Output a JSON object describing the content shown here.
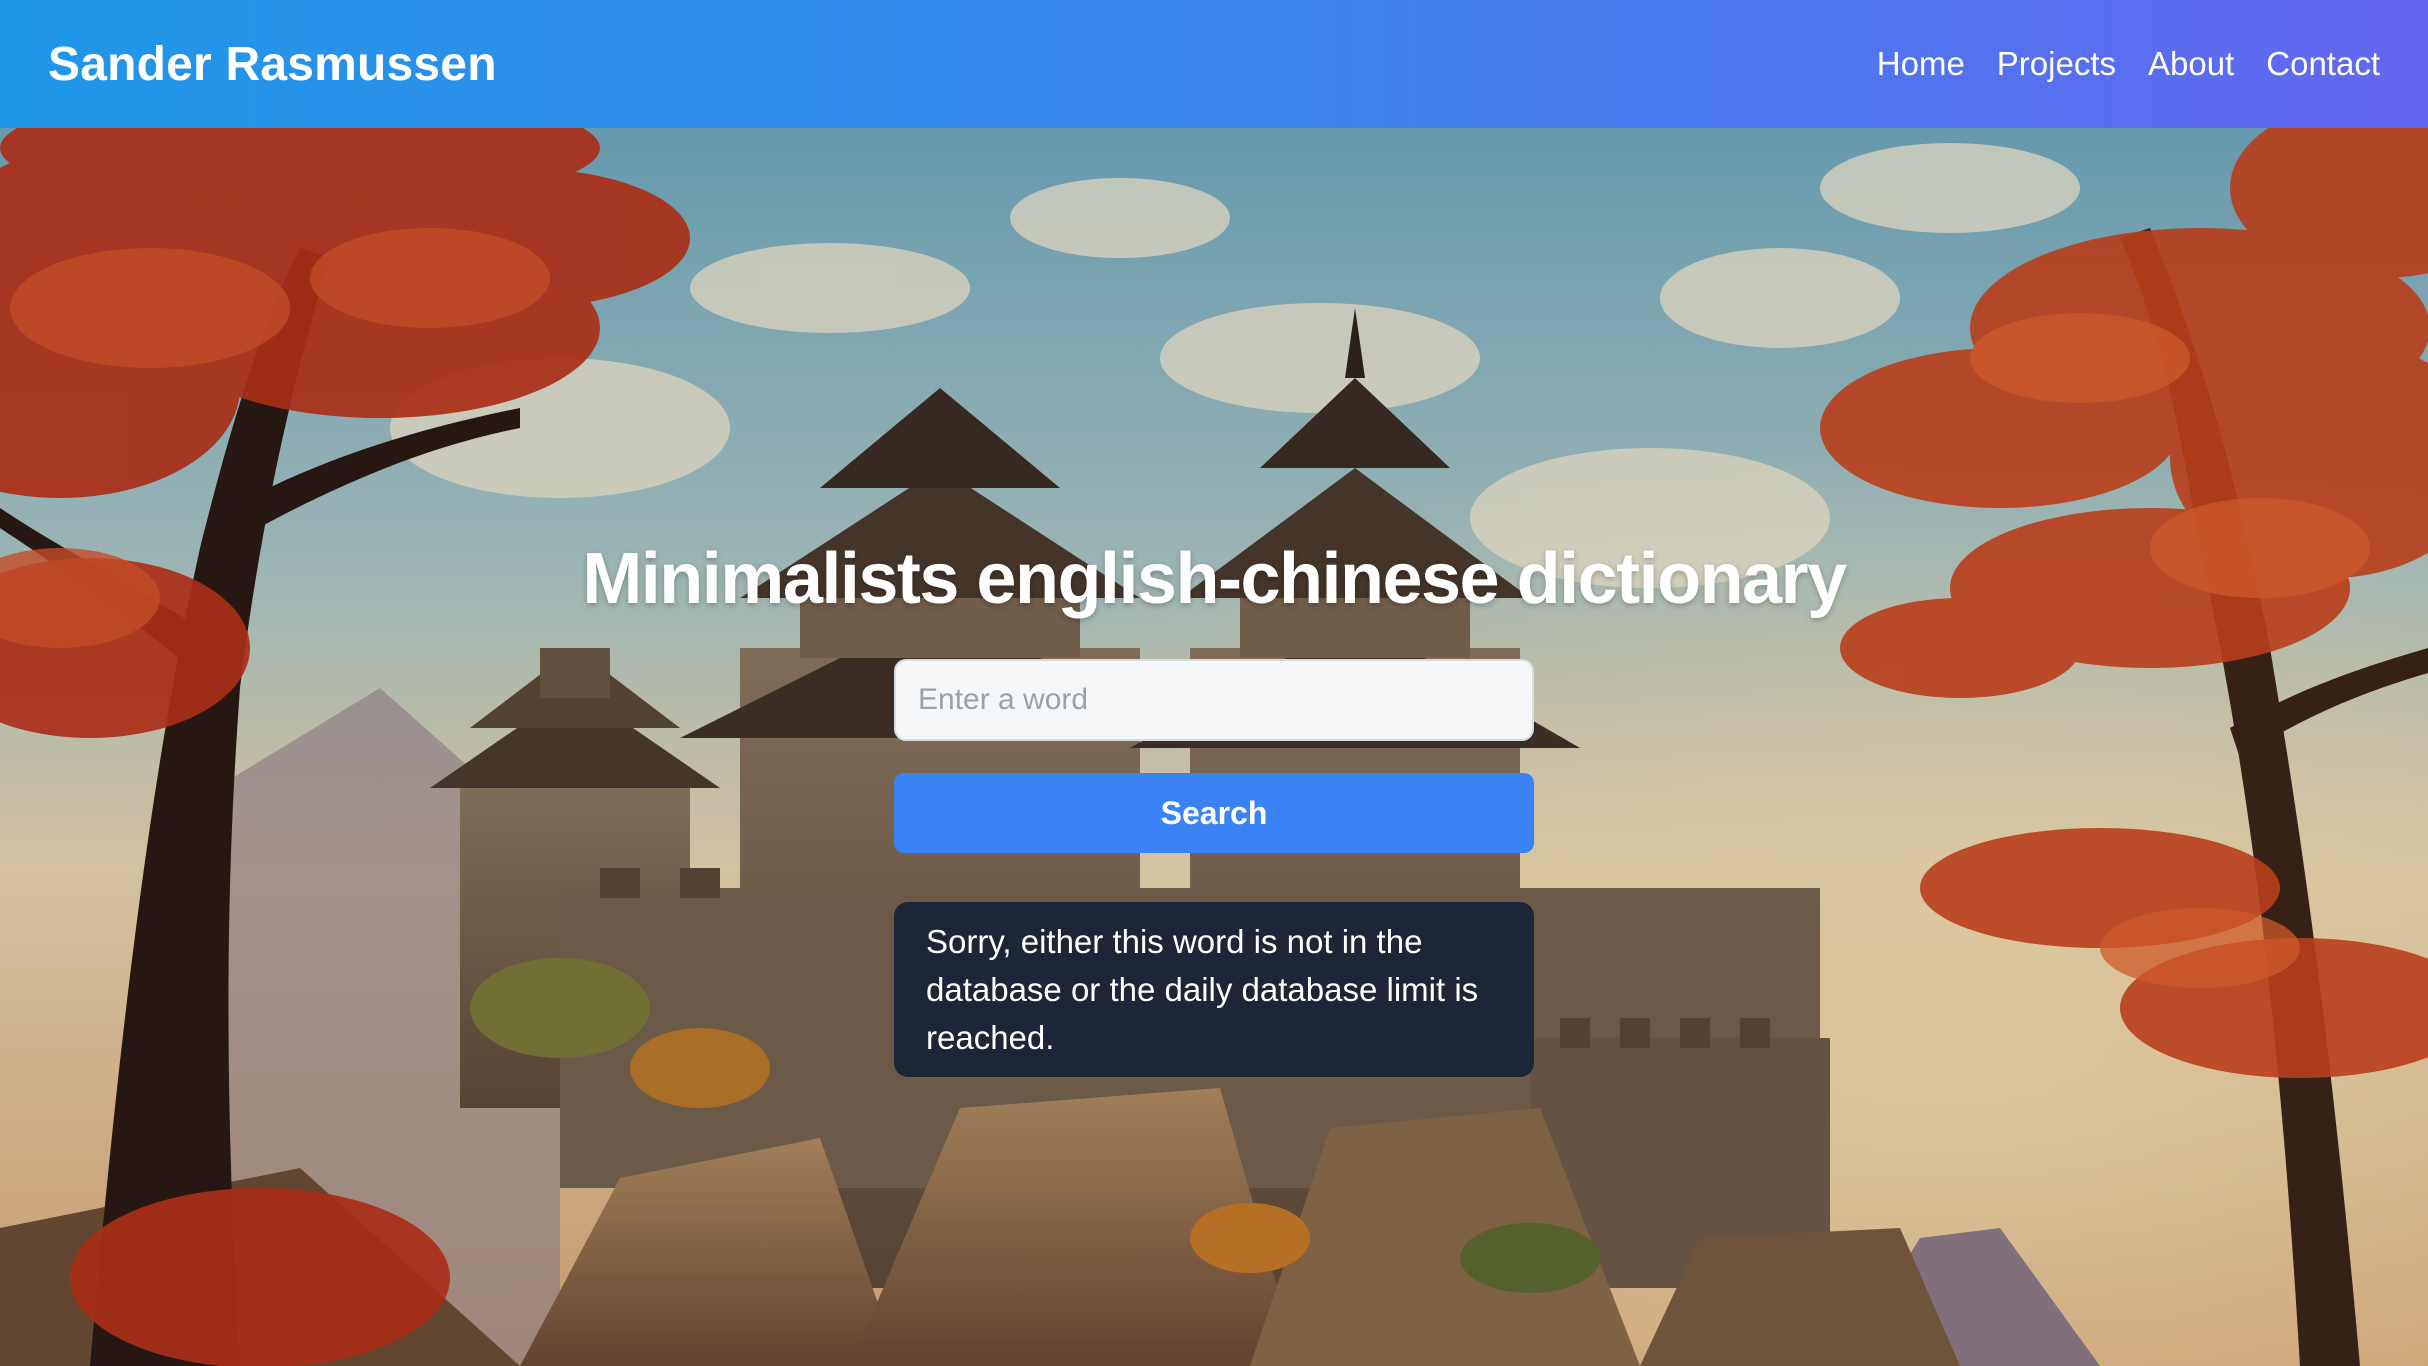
{
  "header": {
    "brand": "Sander Rasmussen",
    "nav": [
      "Home",
      "Projects",
      "About",
      "Contact"
    ],
    "gradient": [
      "#1f97e8",
      "#6366f1"
    ]
  },
  "hero": {
    "title": "Minimalists english-chinese dictionary",
    "search": {
      "placeholder": "Enter a word",
      "value": ""
    },
    "button_label": "Search",
    "message": "Sorry, either this word is not in the database or the daily database limit is reached."
  },
  "colors": {
    "button": "#3b82f6",
    "message_bg": "#1c2637"
  }
}
